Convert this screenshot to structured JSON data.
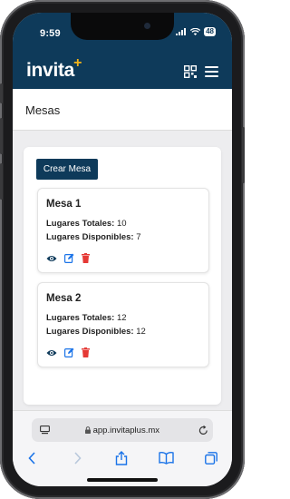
{
  "status": {
    "time": "9:59",
    "battery": "48"
  },
  "nav": {
    "logo_text": "invita",
    "logo_plus": "+"
  },
  "page": {
    "title": "Mesas"
  },
  "actions": {
    "create_label": "Crear Mesa"
  },
  "mesas": [
    {
      "title": "Mesa 1",
      "total_label": "Lugares Totales:",
      "total": "10",
      "disp_label": "Lugares Disponibles:",
      "disp": "7"
    },
    {
      "title": "Mesa 2",
      "total_label": "Lugares Totales:",
      "total": "12",
      "disp_label": "Lugares Disponibles:",
      "disp": "12"
    }
  ],
  "browser": {
    "url": "app.invitaplus.mx"
  },
  "colors": {
    "brand": "#0e3a5a",
    "accent": "#f2b31a",
    "edit": "#1a73e8",
    "delete": "#e53935"
  }
}
